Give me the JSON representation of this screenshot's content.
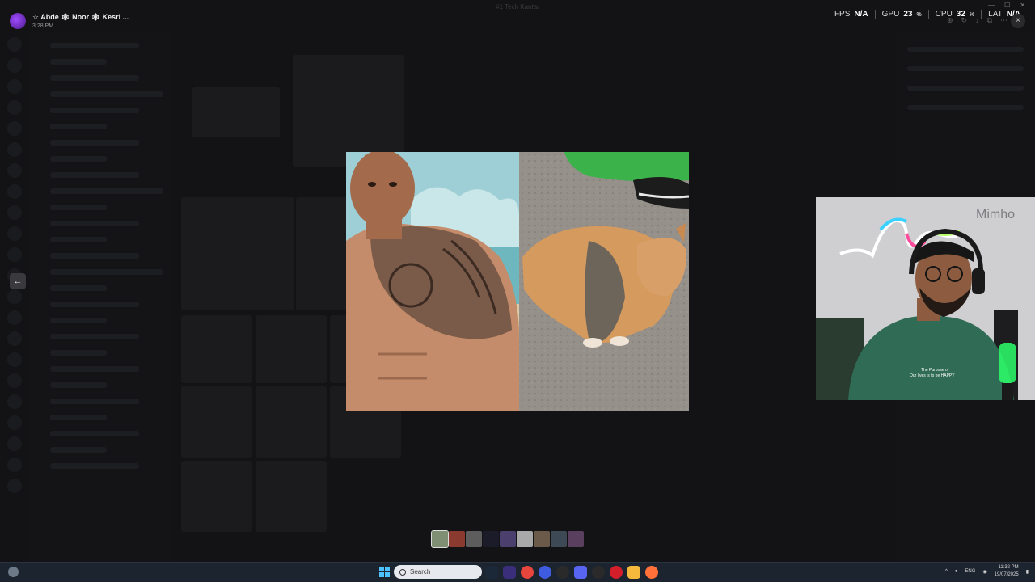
{
  "viewer": {
    "username": "☆ Abde 🕸 Noor 🕸 Kesri ...",
    "timestamp": "3:28 PM"
  },
  "window": {
    "title": "#1 Tech Kantar"
  },
  "perf": {
    "fps_label": "FPS",
    "fps_value": "N/A",
    "gpu_label": "GPU",
    "gpu_value": "23",
    "cpu_label": "CPU",
    "cpu_value": "32",
    "percent_unit": "%",
    "lat_label": "LAT",
    "lat_value": "N/A"
  },
  "icons": {
    "close": "×",
    "prev_arrow": "←",
    "zoom": "⊕",
    "rotate": "↻",
    "download": "↓",
    "open": "⧉",
    "more": "⋯",
    "minimize": "—",
    "maximize": "☐",
    "win_close": "✕"
  },
  "webcam": {
    "wall_sign": "Mimho",
    "shirt_text_1": "The Purpose of",
    "shirt_text_2": "Our lives is to be HAPPY"
  },
  "thumbnails": [
    {
      "color": "#7e8f74",
      "active": true
    },
    {
      "color": "#8b3a2f",
      "active": false
    },
    {
      "color": "#5d5d5d",
      "active": false
    },
    {
      "color": "#1b1b2a",
      "active": false
    },
    {
      "color": "#4b3f6e",
      "active": false
    },
    {
      "color": "#a9a9a9",
      "active": false
    },
    {
      "color": "#6b5a4a",
      "active": false
    },
    {
      "color": "#3d4a55",
      "active": false
    },
    {
      "color": "#5a3f5f",
      "active": false
    }
  ],
  "taskbar": {
    "search_placeholder": "Search",
    "language": "ENG",
    "time": "11:32 PM",
    "date": "19/07/2025"
  },
  "colors": {
    "accent_windows": "#4cc2ff",
    "discord_blurple": "#5865f2",
    "webcam_shirt": "#2f6b55"
  }
}
